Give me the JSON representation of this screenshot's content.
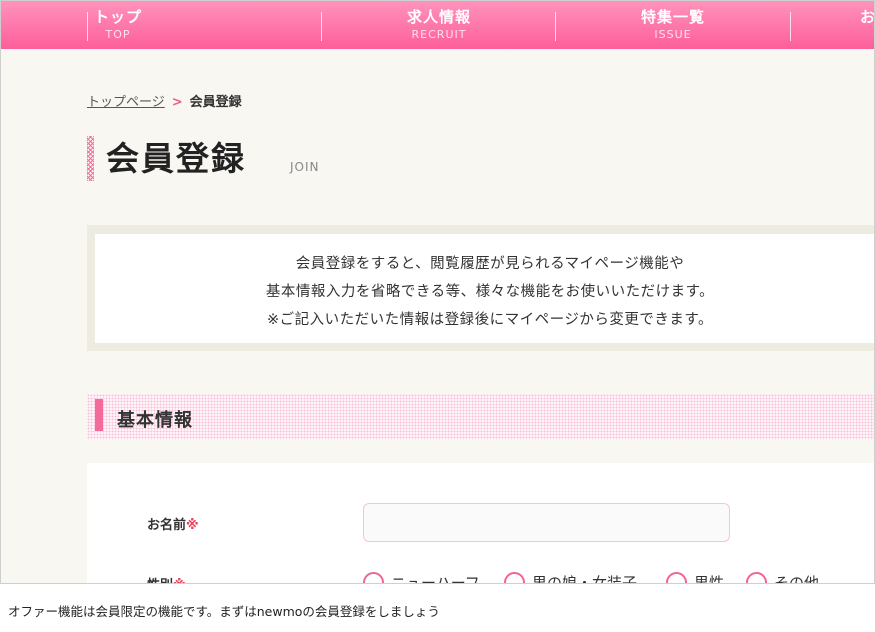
{
  "nav": {
    "items": [
      {
        "jp": "トップ",
        "en": "TOP"
      },
      {
        "jp": "求人情報",
        "en": "RECRUIT"
      },
      {
        "jp": "特集一覧",
        "en": "ISSUE"
      },
      {
        "jp": "お",
        "en": ""
      }
    ]
  },
  "breadcrumb": {
    "home": "トップページ",
    "separator": ">",
    "current": "会員登録"
  },
  "heading": {
    "title": "会員登録",
    "subtitle": "JOIN"
  },
  "info": {
    "lines": [
      "会員登録をすると、閲覧履歴が見られるマイページ機能や",
      "基本情報入力を省略できる等、様々な機能をお使いいただけます。",
      "※ご記入いただいた情報は登録後にマイページから変更できます。"
    ]
  },
  "section": {
    "title": "基本情報"
  },
  "form": {
    "name_label": "お名前",
    "name_value": "",
    "required_mark": "※",
    "gender_label": "性別",
    "gender_options": [
      "ニューハーフ",
      "男の娘・女装子",
      "男性",
      "その他"
    ]
  },
  "caption": "オファー機能は会員限定の機能です。まずはnewmoの会員登録をしましょう",
  "colors": {
    "accent": "#fd5e9a",
    "required": "#e4435b"
  }
}
